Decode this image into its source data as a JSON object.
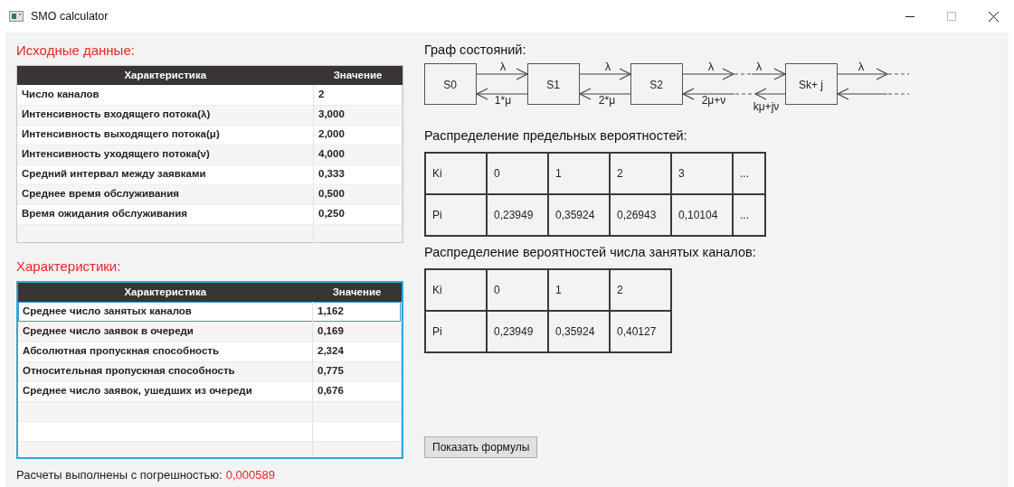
{
  "window": {
    "title": "SMO calculator"
  },
  "input_table": {
    "title": "Исходные данные:",
    "focused": false,
    "columns": [
      "Характеристика",
      "Значение"
    ],
    "rows": [
      {
        "name": "Число каналов",
        "value": "2",
        "selected": false
      },
      {
        "name": "Интенсивность входящего потока(λ)",
        "value": "3,000",
        "selected": false
      },
      {
        "name": "Интенсивность выходящего потока(μ)",
        "value": "2,000",
        "selected": false
      },
      {
        "name": "Интенсивность уходящего потока(ν)",
        "value": "4,000",
        "selected": false
      },
      {
        "name": "Средний интервал между заявками",
        "value": "0,333",
        "selected": false
      },
      {
        "name": "Среднее время обслуживания",
        "value": "0,500",
        "selected": false
      },
      {
        "name": "Время ожидания обслуживания",
        "value": "0,250",
        "selected": false
      }
    ]
  },
  "results_table": {
    "title": "Характеристики:",
    "focused": true,
    "columns": [
      "Характеристика",
      "Значение"
    ],
    "rows": [
      {
        "name": "Среднее число занятых каналов",
        "value": "1,162",
        "selected": true
      },
      {
        "name": "Среднее число заявок в очереди",
        "value": "0,169",
        "selected": false
      },
      {
        "name": "Абсолютная пропускная способность",
        "value": "2,324",
        "selected": false
      },
      {
        "name": "Относительная пропускная способность",
        "value": "0,775",
        "selected": false
      },
      {
        "name": "Среднее число заявок, ушедших из очереди",
        "value": "0,676",
        "selected": false
      }
    ]
  },
  "state_graph": {
    "title": "Граф состояний:",
    "states": [
      "S0",
      "S1",
      "S2",
      "Sk+ j"
    ],
    "forward_labels": [
      "λ",
      "λ",
      "λ",
      "λ",
      "λ"
    ],
    "backward_labels": [
      "1*μ",
      "2*μ",
      "2μ+ν",
      "kμ+jν"
    ]
  },
  "limit_probabilities": {
    "title": "Распределение предельных вероятностей:",
    "rows": [
      [
        "Ki",
        "0",
        "1",
        "2",
        "3",
        "..."
      ],
      [
        "Pi",
        "0,23949",
        "0,35924",
        "0,26943",
        "0,10104",
        "..."
      ]
    ]
  },
  "busy_channel_probabilities": {
    "title": "Распределение вероятностей числа занятых каналов:",
    "rows": [
      [
        "Ki",
        "0",
        "1",
        "2"
      ],
      [
        "Pi",
        "0,23949",
        "0,35924",
        "0,40127"
      ]
    ]
  },
  "formulas_button": "Показать формулы",
  "status": {
    "label": "Расчеты выполнены с погрешностью:",
    "value": "0,000589"
  }
}
